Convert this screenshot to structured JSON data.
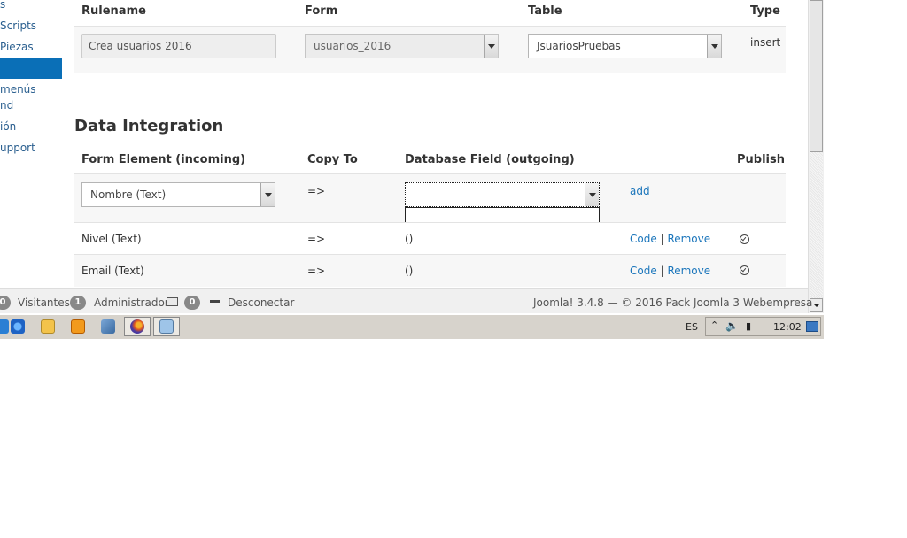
{
  "sidebar": {
    "items": [
      "s",
      "Scripts",
      "Piezas",
      "",
      "menús",
      "nd",
      "ión",
      "upport"
    ]
  },
  "rules_table": {
    "headers": {
      "rulename": "Rulename",
      "form": "Form",
      "table": "Table",
      "type": "Type"
    },
    "row": {
      "rulename_value": "Crea usuarios 2016",
      "form_value": "usuarios_2016",
      "table_value": "JsuariosPruebas",
      "type_value": "insert"
    }
  },
  "integration": {
    "title": "Data Integration",
    "headers": {
      "form_element": "Form Element (incoming)",
      "copy_to": "Copy To",
      "db_field": "Database Field (outgoing)",
      "publish": "Publish"
    },
    "new_row": {
      "form_element_value": "Nombre (Text)",
      "arrow": "=>",
      "db_field_value": "",
      "add_label": "add"
    },
    "rows": [
      {
        "element": "Nivel (Text)",
        "arrow": "=>",
        "field": "()",
        "code": "Code",
        "sep": "|",
        "remove": "Remove"
      },
      {
        "element": "Email (Text)",
        "arrow": "=>",
        "field": "()",
        "code": "Code",
        "sep": "|",
        "remove": "Remove"
      }
    ]
  },
  "statusbar": {
    "visitors_count": "0",
    "visitors_label": "Visitantes",
    "admin_count": "1",
    "admin_label": "Administrador",
    "msg_count": "0",
    "logout_label": "Desconectar",
    "version_text": "Joomla! 3.4.8 — © 2016 Pack Joomla 3 Webempresa"
  },
  "taskbar": {
    "language": "ES",
    "clock": "12:02",
    "apps": [
      "ie-icon",
      "explorer-icon",
      "media-player-icon",
      "tools-icon",
      "firefox-icon",
      "app-icon"
    ]
  },
  "colors": {
    "accent": "#0a6fb7",
    "link": "#1a75bb",
    "row_bg": "#f7f7f7"
  }
}
